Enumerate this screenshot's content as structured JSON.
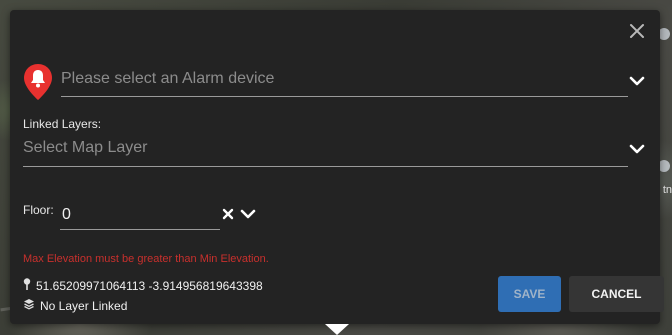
{
  "dialog": {
    "alarm_placeholder": "Please select an Alarm device",
    "linked_layers_label": "Linked Layers:",
    "map_layer_placeholder": "Select Map Layer",
    "floor_label": "Floor:",
    "floor_value": "0",
    "error_text": "Max Elevation must be greater than Min Elevation.",
    "coordinates": "51.65209971064113 -3.914956819643398",
    "layer_status": "No Layer Linked",
    "save_label": "SAVE",
    "cancel_label": "CANCEL"
  },
  "map": {
    "side_text": "tn"
  },
  "icons": {
    "close": "close-icon",
    "alarm": "bell-marker-icon",
    "chevron": "chevron-down-icon",
    "clear": "clear-icon",
    "location": "location-pin-icon",
    "layers": "layers-icon"
  },
  "colors": {
    "panel": "#232323",
    "accent": "#2f6eb4",
    "marker": "#e8312f",
    "error": "#c8302d"
  }
}
